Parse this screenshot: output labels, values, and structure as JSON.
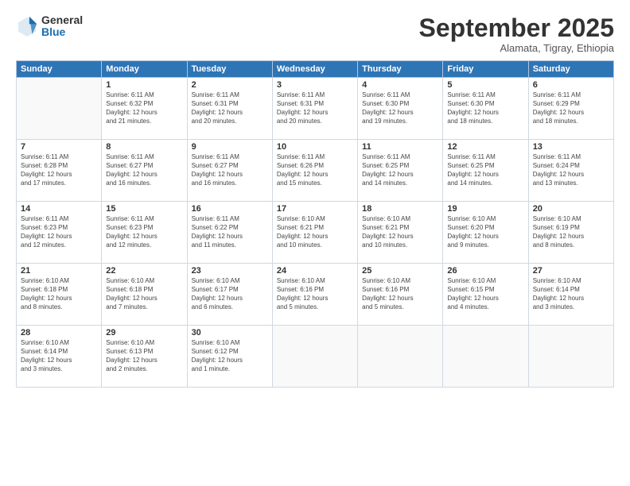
{
  "logo": {
    "general": "General",
    "blue": "Blue"
  },
  "header": {
    "month": "September 2025",
    "location": "Alamata, Tigray, Ethiopia"
  },
  "weekdays": [
    "Sunday",
    "Monday",
    "Tuesday",
    "Wednesday",
    "Thursday",
    "Friday",
    "Saturday"
  ],
  "weeks": [
    [
      {
        "day": "",
        "info": ""
      },
      {
        "day": "1",
        "info": "Sunrise: 6:11 AM\nSunset: 6:32 PM\nDaylight: 12 hours\nand 21 minutes."
      },
      {
        "day": "2",
        "info": "Sunrise: 6:11 AM\nSunset: 6:31 PM\nDaylight: 12 hours\nand 20 minutes."
      },
      {
        "day": "3",
        "info": "Sunrise: 6:11 AM\nSunset: 6:31 PM\nDaylight: 12 hours\nand 20 minutes."
      },
      {
        "day": "4",
        "info": "Sunrise: 6:11 AM\nSunset: 6:30 PM\nDaylight: 12 hours\nand 19 minutes."
      },
      {
        "day": "5",
        "info": "Sunrise: 6:11 AM\nSunset: 6:30 PM\nDaylight: 12 hours\nand 18 minutes."
      },
      {
        "day": "6",
        "info": "Sunrise: 6:11 AM\nSunset: 6:29 PM\nDaylight: 12 hours\nand 18 minutes."
      }
    ],
    [
      {
        "day": "7",
        "info": "Sunrise: 6:11 AM\nSunset: 6:28 PM\nDaylight: 12 hours\nand 17 minutes."
      },
      {
        "day": "8",
        "info": "Sunrise: 6:11 AM\nSunset: 6:27 PM\nDaylight: 12 hours\nand 16 minutes."
      },
      {
        "day": "9",
        "info": "Sunrise: 6:11 AM\nSunset: 6:27 PM\nDaylight: 12 hours\nand 16 minutes."
      },
      {
        "day": "10",
        "info": "Sunrise: 6:11 AM\nSunset: 6:26 PM\nDaylight: 12 hours\nand 15 minutes."
      },
      {
        "day": "11",
        "info": "Sunrise: 6:11 AM\nSunset: 6:25 PM\nDaylight: 12 hours\nand 14 minutes."
      },
      {
        "day": "12",
        "info": "Sunrise: 6:11 AM\nSunset: 6:25 PM\nDaylight: 12 hours\nand 14 minutes."
      },
      {
        "day": "13",
        "info": "Sunrise: 6:11 AM\nSunset: 6:24 PM\nDaylight: 12 hours\nand 13 minutes."
      }
    ],
    [
      {
        "day": "14",
        "info": "Sunrise: 6:11 AM\nSunset: 6:23 PM\nDaylight: 12 hours\nand 12 minutes."
      },
      {
        "day": "15",
        "info": "Sunrise: 6:11 AM\nSunset: 6:23 PM\nDaylight: 12 hours\nand 12 minutes."
      },
      {
        "day": "16",
        "info": "Sunrise: 6:11 AM\nSunset: 6:22 PM\nDaylight: 12 hours\nand 11 minutes."
      },
      {
        "day": "17",
        "info": "Sunrise: 6:10 AM\nSunset: 6:21 PM\nDaylight: 12 hours\nand 10 minutes."
      },
      {
        "day": "18",
        "info": "Sunrise: 6:10 AM\nSunset: 6:21 PM\nDaylight: 12 hours\nand 10 minutes."
      },
      {
        "day": "19",
        "info": "Sunrise: 6:10 AM\nSunset: 6:20 PM\nDaylight: 12 hours\nand 9 minutes."
      },
      {
        "day": "20",
        "info": "Sunrise: 6:10 AM\nSunset: 6:19 PM\nDaylight: 12 hours\nand 8 minutes."
      }
    ],
    [
      {
        "day": "21",
        "info": "Sunrise: 6:10 AM\nSunset: 6:18 PM\nDaylight: 12 hours\nand 8 minutes."
      },
      {
        "day": "22",
        "info": "Sunrise: 6:10 AM\nSunset: 6:18 PM\nDaylight: 12 hours\nand 7 minutes."
      },
      {
        "day": "23",
        "info": "Sunrise: 6:10 AM\nSunset: 6:17 PM\nDaylight: 12 hours\nand 6 minutes."
      },
      {
        "day": "24",
        "info": "Sunrise: 6:10 AM\nSunset: 6:16 PM\nDaylight: 12 hours\nand 5 minutes."
      },
      {
        "day": "25",
        "info": "Sunrise: 6:10 AM\nSunset: 6:16 PM\nDaylight: 12 hours\nand 5 minutes."
      },
      {
        "day": "26",
        "info": "Sunrise: 6:10 AM\nSunset: 6:15 PM\nDaylight: 12 hours\nand 4 minutes."
      },
      {
        "day": "27",
        "info": "Sunrise: 6:10 AM\nSunset: 6:14 PM\nDaylight: 12 hours\nand 3 minutes."
      }
    ],
    [
      {
        "day": "28",
        "info": "Sunrise: 6:10 AM\nSunset: 6:14 PM\nDaylight: 12 hours\nand 3 minutes."
      },
      {
        "day": "29",
        "info": "Sunrise: 6:10 AM\nSunset: 6:13 PM\nDaylight: 12 hours\nand 2 minutes."
      },
      {
        "day": "30",
        "info": "Sunrise: 6:10 AM\nSunset: 6:12 PM\nDaylight: 12 hours\nand 1 minute."
      },
      {
        "day": "",
        "info": ""
      },
      {
        "day": "",
        "info": ""
      },
      {
        "day": "",
        "info": ""
      },
      {
        "day": "",
        "info": ""
      }
    ]
  ]
}
